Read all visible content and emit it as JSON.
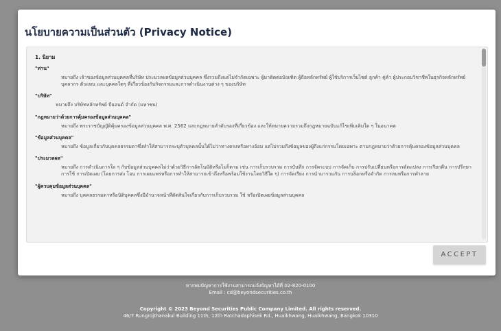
{
  "modal": {
    "title": "นโยบายความเป็นส่วนตัว (Privacy Notice)",
    "section_title": "1. นิยาม",
    "definitions": [
      {
        "term": "\"ท่าน\"",
        "text": "หมายถึง เจ้าของข้อมูลส่วนบุคคลที่บริษัท ประมวลผลข้อมูลส่วนบุคคล ซึ่งรวมถึงแต่ไม่จำกัดเฉพาะ ผู้มาติดต่อบัณฑิต ผู้ถือหลักทรัพย์ ผู้ใช้บริการเว็บไซต์ ลูกค้า คู่ค้า ผู้ประกอบวิชาชีพในธุรกิจหลักทรัพย์ บุคลากร ตัวแทน และบุคคลใดๆ ที่เกี่ยวข้องกับกิจกรรมและการดำเนินงานต่าง ๆ ของบริษัท"
      },
      {
        "term": "\"บริษัท\"",
        "text": "หมายถึง บริษัทหลักทรัพย์ บียอนด์ จำกัด (มหาชน)",
        "narrow": true
      },
      {
        "term": "\"กฎหมายว่าด้วยการคุ้มครองข้อมูลส่วนบุคคล\"",
        "text": "หมายถึง พระราชบัญญัติคุ้มครองข้อมูลส่วนบุคคล พ.ศ. 2562 และกฎหมายลำดับรองที่เกี่ยวข้อง และให้หมายความรวมถึงกฎหมายฉบับแก้ไขเพิ่มเติมใด ๆ ในอนาคต"
      },
      {
        "term": "\"ข้อมูลส่วนบุคคล\"",
        "text": "หมายถึง ข้อมูลเกี่ยวกับบุคคลธรรมดาซึ่งทำให้สามารถระบุตัวบุคคลนั้นได้ไม่ว่าทางตรงหรือทางอ้อม แต่ไม่รวมถึงข้อมูลของผู้ถึงแก่กรรมโดยเฉพาะ ตามกฎหมายว่าด้วยการคุ้มครองข้อมูลส่วนบุคคล"
      },
      {
        "term": "\"ประมวลผล\"",
        "text": "หมายถึง การดำเนินการใด ๆ กับข้อมูลส่วนบุคคลไม่ว่าด้วยวิธีการอัตโนมัติหรือไม่ก็ตาม เช่น การเก็บรวบรวม การบันทึก การจัดระบบ การจัดเก็บ การปรับเปลี่ยนหรือการดัดแปลง การเรียกคืน การปรึกษา การใช้ การเปิดเผย (โดยการส่ง โอน การเผยแพร่หรือการทำให้สามารถเข้าถึงหรือพร้อมใช้งานโดยวิธีใด ๆ) การจัดเรียง การนำมารวมกัน การบล็อกหรือจำกัด การลบหรือการทำลาย"
      },
      {
        "term": "\"ผู้ควบคุมข้อมูลส่วนบุคคล\"",
        "text": "หมายถึง บุคคลธรรมดาหรือนิติบุคคลซึ่งมีอำนาจหน้าที่ตัดสินใจเกี่ยวกับการเก็บรวบรวม ใช้ หรือเปิดเผยข้อมูลส่วนบุคคล"
      }
    ],
    "accept_label": "ACCEPT"
  },
  "footer": {
    "contact_line": "หากพบปัญหาการใช้งานสามารถแจ้งปัญหาได้ที่ 02-820-0100",
    "email_line": "Email : cd@beyondsecurities.co.th",
    "copyright": "Copyright © 2023 Beyond Securities Public Company Limited. All rights reserved.",
    "address": "46/7 Rungrojthanakul Building 11th, 12th Ratchadaphisek Rd., Huaikhwang, Huaikhwang, Bangkok 10310"
  }
}
